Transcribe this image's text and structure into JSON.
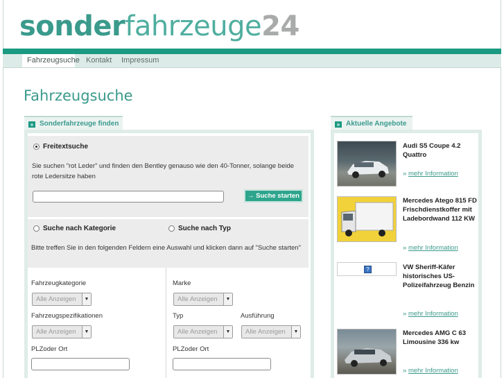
{
  "logo": {
    "part1": "sonder",
    "part2": "fahrzeuge",
    "part3": "24"
  },
  "nav": {
    "items": [
      "Fahrzeugsuche",
      "Kontakt",
      "Impressum"
    ]
  },
  "page_title": "Fahrzeugsuche",
  "search_panel": {
    "tab_label": "Sonderfahrzeuge finden",
    "freetext_label": "Freitextsuche",
    "freetext_desc": "Sie suchen \"rot Leder\" und finden den Bentley genauso wie den 40-Tonner, solange beide rote Ledersitze haben",
    "freetext_value": "",
    "search_button": "→ Suche starten",
    "category_label": "Suche nach Kategorie",
    "type_label": "Suche nach Typ",
    "category_desc": "Bitte treffen Sie in den folgenden Feldern eine Auswahl und klicken dann auf \"Suche starten\"",
    "left": {
      "kategorie_label": "Fahrzeugkategorie",
      "kategorie_value": "Alle Anzeigen",
      "spezifikation_label": "Fahrzeugspezifikationen",
      "spezifikation_value": "Alle Anzeigen",
      "plz_label": "PLZoder Ort",
      "plz_value": ""
    },
    "right": {
      "marke_label": "Marke",
      "marke_value": "Alle Anzeigen",
      "typ_label": "Typ",
      "typ_value": "Alle Anzeigen",
      "ausfuehrung_label": "Ausführung",
      "ausfuehrung_value": "Alle Anzeigen",
      "plz_label": "PLZoder Ort",
      "plz_value": ""
    }
  },
  "offers_panel": {
    "tab_label": "Aktuelle Angebote",
    "more_label": "mehr Information",
    "more_prefix": "»",
    "offers": [
      {
        "title": "Audi S5 Coupe 4.2 Quattro"
      },
      {
        "title": "Mercedes Atego 815 FD Frischdienstkoffer mit Ladebordwand 112 KW"
      },
      {
        "title": "VW Sheriff-Käfer historisches US-Polizeifahrzeug Benzin"
      },
      {
        "title": "Mercedes AMG C 63 Limousine 336 kw"
      }
    ]
  },
  "colors": {
    "brand": "#1b9a82",
    "accent_text": "#3a9a8c",
    "logo_gray": "#a9aaaa"
  }
}
